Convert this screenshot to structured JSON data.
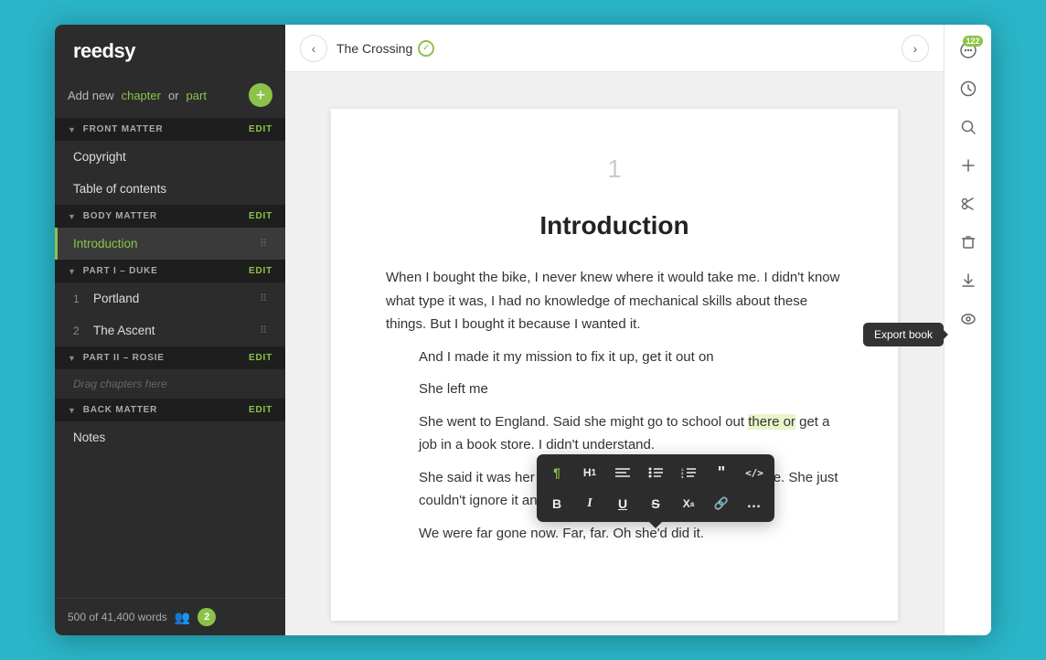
{
  "app": {
    "logo": "reedsy"
  },
  "sidebar": {
    "add_text": "Add new",
    "add_chapter": "chapter",
    "add_or": "or",
    "add_part": "part",
    "front_matter_label": "FRONT MATTER",
    "front_matter_edit": "EDIT",
    "copyright_label": "Copyright",
    "toc_label": "Table of contents",
    "body_matter_label": "BODY MATTER",
    "body_matter_edit": "EDIT",
    "introduction_label": "Introduction",
    "part1_label": "PART I – Duke",
    "part1_edit": "EDIT",
    "item1_num": "1",
    "item1_label": "Portland",
    "item2_num": "2",
    "item2_label": "The Ascent",
    "part2_label": "PART II – Rosie",
    "part2_edit": "EDIT",
    "drag_placeholder": "Drag chapters here",
    "back_matter_label": "BACK MATTER",
    "back_matter_edit": "EDIT",
    "notes_label": "Notes",
    "word_count": "500 of 41,400 words",
    "collab_count": "2"
  },
  "topbar": {
    "chapter_title": "The Crossing",
    "back_arrow": "‹",
    "next_arrow": "›"
  },
  "editor": {
    "page_number": "1",
    "chapter_heading": "Introduction",
    "paragraph1": "When I bought the bike, I never knew where it would take me. I didn't know what type it was, I had no knowledge of mechanical skills about these things. But I bought it because I wanted it.",
    "paragraph2_indent": "And I made it my mission to fix it up, get it out on",
    "paragraph3_indent": "She left me",
    "paragraph4_indent": "She went to England. Said she might go to school out there or get a job in a book store. I didn't understand.",
    "paragraph5_indent": "She said it was her calling. Something was pulling her there. She just couldn't ignore it any longer.",
    "paragraph6_indent": "We were far gone now. Far, far. Oh she'd did it."
  },
  "toolbar": {
    "row1": [
      {
        "id": "paragraph",
        "icon": "¶",
        "label": "paragraph"
      },
      {
        "id": "h1",
        "icon": "H₁",
        "label": "heading-1"
      },
      {
        "id": "align",
        "icon": "≡",
        "label": "align"
      },
      {
        "id": "list-ul",
        "icon": "≡",
        "label": "unordered-list"
      },
      {
        "id": "list-ol",
        "icon": "1≡",
        "label": "ordered-list"
      },
      {
        "id": "quote",
        "icon": "❝",
        "label": "blockquote"
      },
      {
        "id": "code",
        "icon": "</>",
        "label": "code"
      }
    ],
    "row2": [
      {
        "id": "bold",
        "icon": "B",
        "label": "bold"
      },
      {
        "id": "italic",
        "icon": "I",
        "label": "italic"
      },
      {
        "id": "underline",
        "icon": "U",
        "label": "underline"
      },
      {
        "id": "strikethrough",
        "icon": "S",
        "label": "strikethrough"
      },
      {
        "id": "superscript",
        "icon": "Xᵃ",
        "label": "superscript"
      },
      {
        "id": "link",
        "icon": "🔗",
        "label": "link"
      },
      {
        "id": "more",
        "icon": "…",
        "label": "more"
      }
    ]
  },
  "right_sidebar": {
    "comment_count": "122",
    "icons": [
      {
        "id": "comments",
        "label": "comments-icon"
      },
      {
        "id": "history",
        "label": "history-icon"
      },
      {
        "id": "search",
        "label": "search-icon"
      },
      {
        "id": "add",
        "label": "add-icon"
      },
      {
        "id": "scissors",
        "label": "scissors-icon"
      },
      {
        "id": "trash",
        "label": "trash-icon"
      },
      {
        "id": "export",
        "label": "export-icon"
      },
      {
        "id": "preview",
        "label": "preview-icon"
      }
    ],
    "export_tooltip": "Export book"
  }
}
